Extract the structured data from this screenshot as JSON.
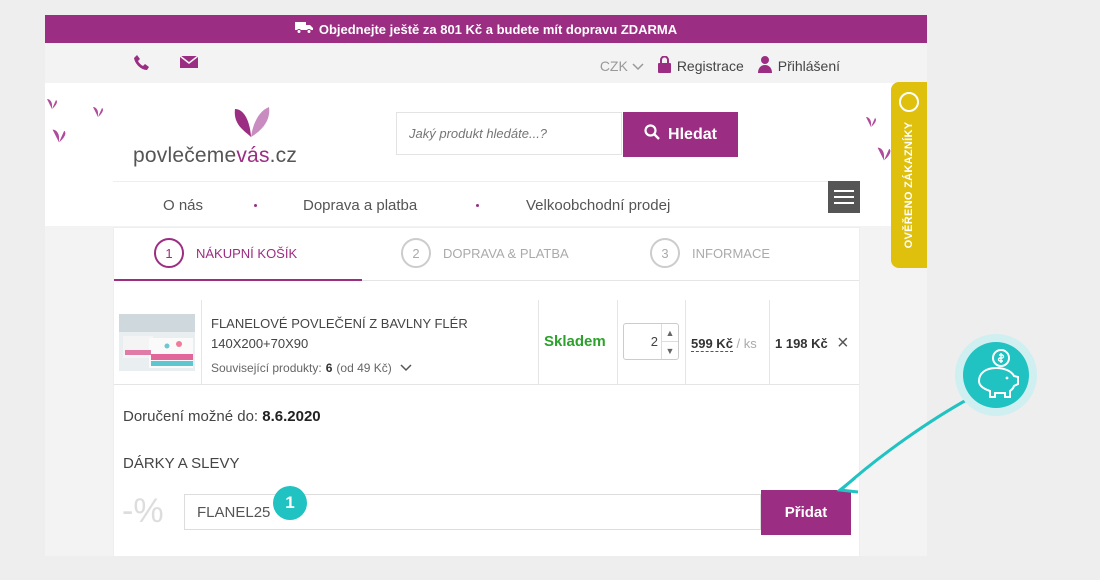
{
  "promo": {
    "text": "Objednejte ještě za 801 Kč a budete mít dopravu ZDARMA",
    "icon": "truck-icon"
  },
  "topbar": {
    "phone_icon": "phone-icon",
    "mail_icon": "mail-icon",
    "currency": "CZK",
    "register": "Registrace",
    "login": "Přihlášení"
  },
  "logo": {
    "main": "povlečeme",
    "accent": "vás",
    "tld": ".cz"
  },
  "search": {
    "placeholder": "Jaký produkt hledáte...?",
    "button": "Hledat"
  },
  "nav": {
    "items": [
      "O nás",
      "Doprava a platba",
      "Velkoobchodní prodej"
    ]
  },
  "steps": [
    {
      "num": "1",
      "label": "NÁKUPNÍ KOŠÍK"
    },
    {
      "num": "2",
      "label": "DOPRAVA & PLATBA"
    },
    {
      "num": "3",
      "label": "INFORMACE"
    }
  ],
  "cart": {
    "item": {
      "name_line1": "FLANELOVÉ POVLEČENÍ Z BAVLNY FLÉR",
      "name_line2": "140X200+70X90",
      "related_label": "Související produkty:",
      "related_count": "6",
      "related_from": "(od 49 Kč)",
      "stock": "Skladem",
      "qty": "2",
      "unit_price": "599 Kč",
      "unit_suffix": "/ ks",
      "total": "1 198 Kč"
    },
    "delivery_label": "Doručení možné do:",
    "delivery_date": "8.6.2020",
    "gifts_title": "DÁRKY A SLEVY",
    "percent_symbol": "-%",
    "coupon_value": "FLANEL25",
    "add_button": "Přidat"
  },
  "annotation": {
    "badge": "1"
  },
  "verified": {
    "text": "OVĚŘENO ZÁKAZNÍKY"
  },
  "colors": {
    "brand": "#9b2d82",
    "stock": "#2ca12c",
    "accent": "#20c2c2",
    "verified": "#dfc00c"
  }
}
